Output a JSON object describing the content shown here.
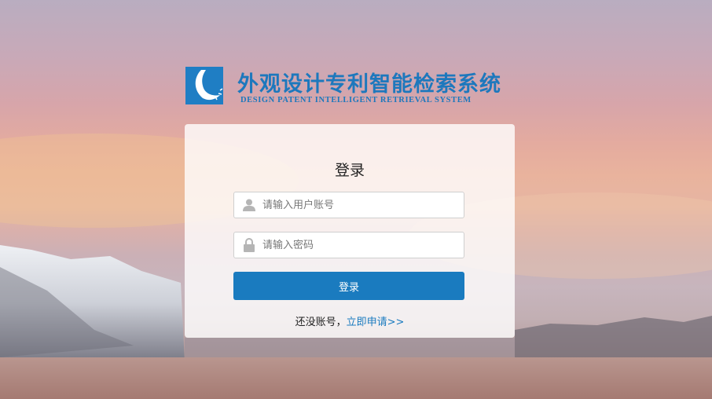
{
  "brand": {
    "title_cn": "外观设计专利智能检索系统",
    "title_en": "DESIGN PATENT INTELLIGENT RETRIEVAL SYSTEM"
  },
  "login": {
    "title": "登录",
    "username_placeholder": "请输入用户账号",
    "password_placeholder": "请输入密码",
    "submit_label": "登录",
    "register_prompt": "还没账号，",
    "register_link": "立即申请>>"
  },
  "colors": {
    "accent": "#1a7bbf",
    "brand": "#1d78bd"
  },
  "icons": [
    "logo-icon",
    "user-icon",
    "lock-icon"
  ]
}
